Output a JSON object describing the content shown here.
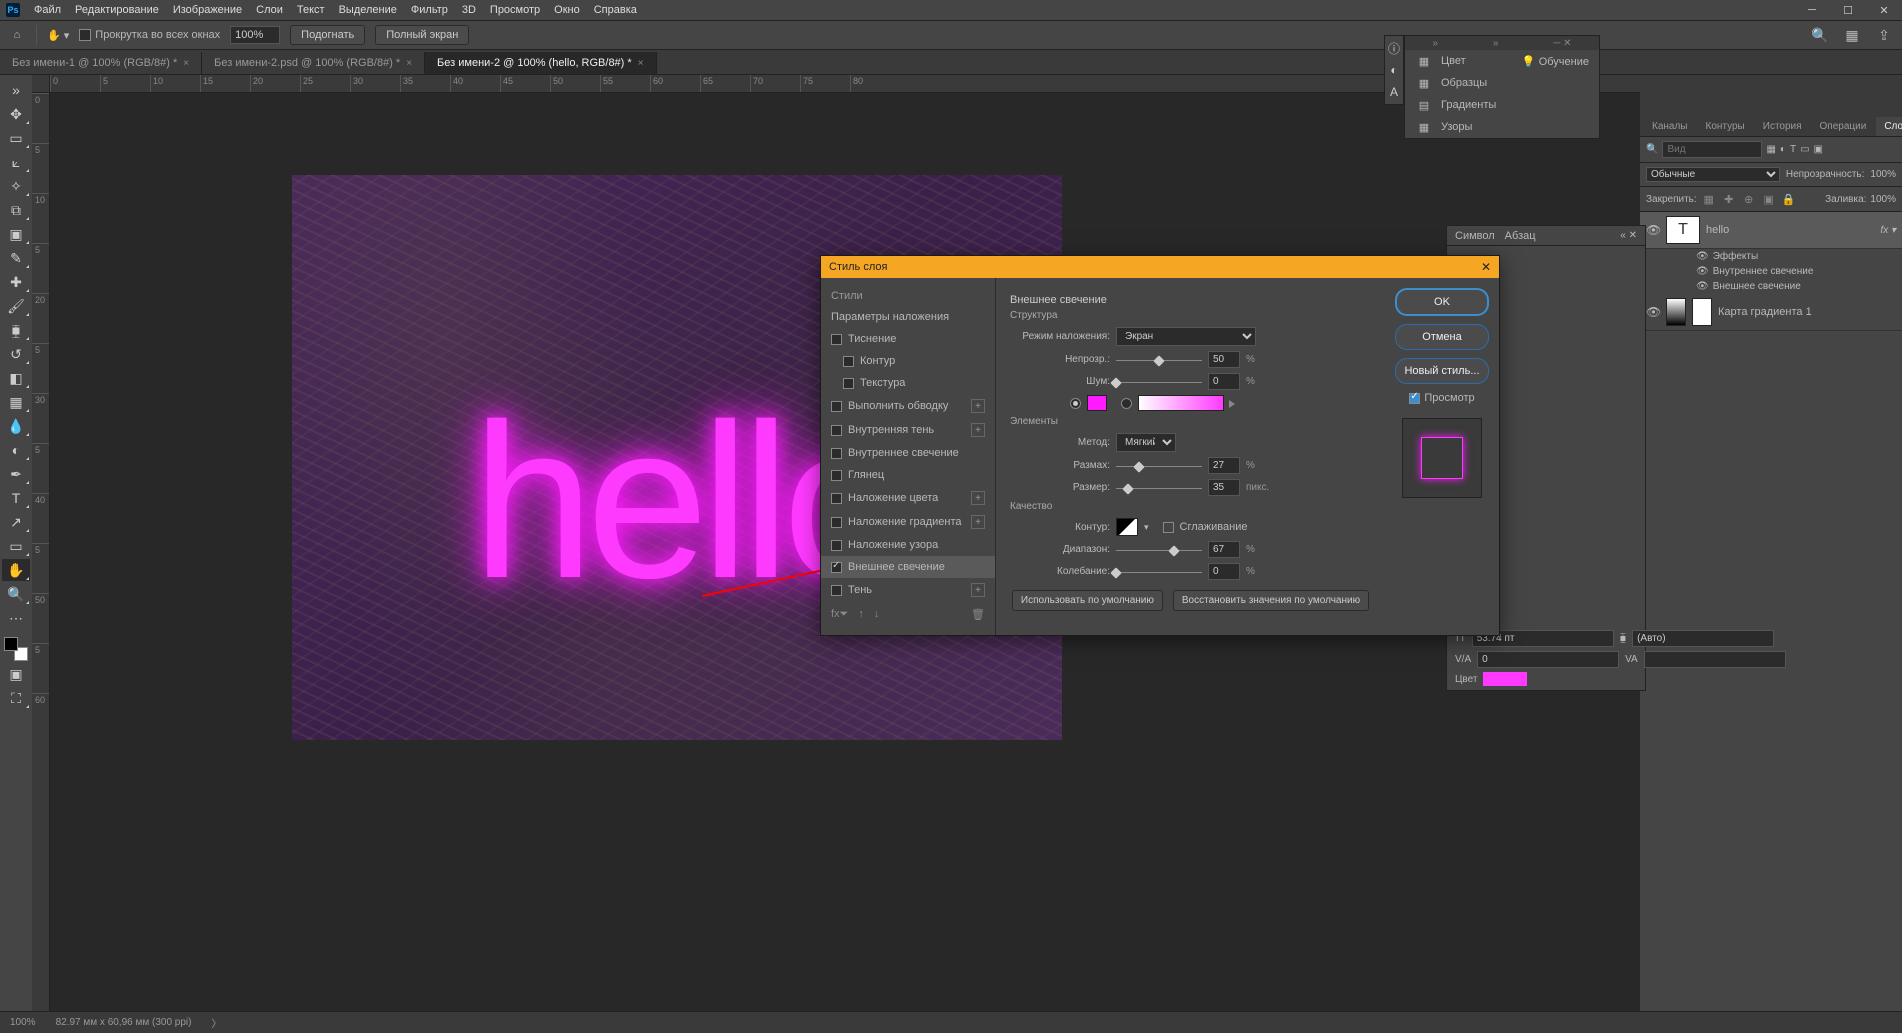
{
  "menu": {
    "items": [
      "Файл",
      "Редактирование",
      "Изображение",
      "Слои",
      "Текст",
      "Выделение",
      "Фильтр",
      "3D",
      "Просмотр",
      "Окно",
      "Справка"
    ]
  },
  "options": {
    "scroll_all": "Прокрутка во всех окнах",
    "zoom": "100%",
    "fit": "Подогнать",
    "full": "Полный экран"
  },
  "tabs": [
    {
      "label": "Без имени-1 @ 100% (RGB/8#) *"
    },
    {
      "label": "Без имени-2.psd @ 100% (RGB/8#) *"
    },
    {
      "label": "Без имени-2 @ 100% (hello, RGB/8#) *"
    }
  ],
  "ruler_h": [
    "0",
    "5",
    "10",
    "15",
    "20",
    "25",
    "30",
    "35",
    "40",
    "45",
    "50",
    "55",
    "60",
    "65",
    "70",
    "75",
    "80"
  ],
  "ruler_v": [
    "0",
    "5",
    "10",
    "5",
    "20",
    "5",
    "30",
    "5",
    "40",
    "5",
    "50",
    "5",
    "60"
  ],
  "canvas_text": "hello",
  "midpanel": {
    "color": "Цвет",
    "learn": "Обучение",
    "swatches": "Образцы",
    "gradients": "Градиенты",
    "patterns": "Узоры"
  },
  "charpanel": {
    "tab1": "Символ",
    "tab2": "Абзац",
    "size": "53.74 пт",
    "leading": "(Авто)",
    "kern": "0",
    "track": "",
    "color_label": "Цвет"
  },
  "layerspanel": {
    "tabs": [
      "Каналы",
      "Контуры",
      "История",
      "Операции",
      "Слои"
    ],
    "search_ph": "Вид",
    "blend": "Обычные",
    "opacity_lbl": "Непрозрачность:",
    "opacity": "100%",
    "lock_lbl": "Закрепить:",
    "fill_lbl": "Заливка:",
    "fill": "100%",
    "layers": [
      {
        "name": "hello",
        "fx": true
      },
      {
        "name": "Карта градиента 1"
      }
    ],
    "fx_title": "Эффекты",
    "fx_items": [
      "Внутреннее свечение",
      "Внешнее свечение"
    ]
  },
  "dialog": {
    "title": "Стиль слоя",
    "left": {
      "styles": "Стили",
      "blend_opts": "Параметры наложения",
      "items": [
        {
          "l": "Тиснение",
          "c": false
        },
        {
          "l": "Контур",
          "c": false,
          "indent": true
        },
        {
          "l": "Текстура",
          "c": false,
          "indent": true
        },
        {
          "l": "Выполнить обводку",
          "c": false,
          "plus": true
        },
        {
          "l": "Внутренняя тень",
          "c": false,
          "plus": true
        },
        {
          "l": "Внутреннее свечение",
          "c": false
        },
        {
          "l": "Глянец",
          "c": false
        },
        {
          "l": "Наложение цвета",
          "c": false,
          "plus": true
        },
        {
          "l": "Наложение градиента",
          "c": false,
          "plus": true
        },
        {
          "l": "Наложение узора",
          "c": false
        },
        {
          "l": "Внешнее свечение",
          "c": true,
          "sel": true
        },
        {
          "l": "Тень",
          "c": false,
          "plus": true
        }
      ]
    },
    "mid": {
      "header": "Внешнее свечение",
      "structure": "Структура",
      "blend_mode_lbl": "Режим наложения:",
      "blend_mode": "Экран",
      "opacity_lbl": "Непрозр.:",
      "opacity": "50",
      "opacity_u": "%",
      "noise_lbl": "Шум:",
      "noise": "0",
      "noise_u": "%",
      "elements": "Элементы",
      "method_lbl": "Метод:",
      "method": "Мягкий",
      "spread_lbl": "Размах:",
      "spread": "27",
      "spread_u": "%",
      "size_lbl": "Размер:",
      "size": "35",
      "size_u": "пикс.",
      "quality": "Качество",
      "contour_lbl": "Контур:",
      "aa": "Сглаживание",
      "range_lbl": "Диапазон:",
      "range": "67",
      "range_u": "%",
      "jitter_lbl": "Колебание:",
      "jitter": "0",
      "jitter_u": "%",
      "use_default": "Использовать по умолчанию",
      "restore_default": "Восстановить значения по умолчанию"
    },
    "right": {
      "ok": "OK",
      "cancel": "Отмена",
      "new_style": "Новый стиль...",
      "preview": "Просмотр"
    }
  },
  "status": {
    "zoom": "100%",
    "doc": "82.97 мм x 60,96 мм (300 ppi)"
  }
}
